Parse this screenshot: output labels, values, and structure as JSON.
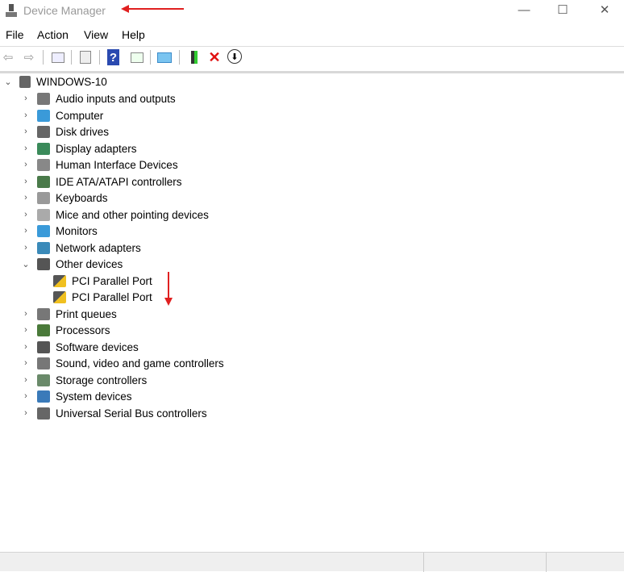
{
  "window": {
    "title": "Device Manager",
    "minimize": "—",
    "maximize": "☐",
    "close": "✕"
  },
  "menu": [
    "File",
    "Action",
    "View",
    "Help"
  ],
  "toolbar": {
    "back": "⇦",
    "forward": "⇨",
    "help": "?",
    "remove": "✕",
    "update": "⬇"
  },
  "tree": {
    "root": "WINDOWS-10",
    "items": [
      {
        "label": "Audio inputs and outputs",
        "color": "#777"
      },
      {
        "label": "Computer",
        "color": "#3a9ad9"
      },
      {
        "label": "Disk drives",
        "color": "#666"
      },
      {
        "label": "Display adapters",
        "color": "#3a8a5a"
      },
      {
        "label": "Human Interface Devices",
        "color": "#888"
      },
      {
        "label": "IDE ATA/ATAPI controllers",
        "color": "#4a7a4a"
      },
      {
        "label": "Keyboards",
        "color": "#999"
      },
      {
        "label": "Mice and other pointing devices",
        "color": "#aaa"
      },
      {
        "label": "Monitors",
        "color": "#3a9ad9"
      },
      {
        "label": "Network adapters",
        "color": "#3a8ab9"
      },
      {
        "label": "Other devices",
        "color": "#555",
        "expanded": true,
        "children": [
          "PCI Parallel Port",
          "PCI Parallel Port"
        ]
      },
      {
        "label": "Print queues",
        "color": "#777"
      },
      {
        "label": "Processors",
        "color": "#4a7a3a"
      },
      {
        "label": "Software devices",
        "color": "#555"
      },
      {
        "label": "Sound, video and game controllers",
        "color": "#777"
      },
      {
        "label": "Storage controllers",
        "color": "#6a8a6a"
      },
      {
        "label": "System devices",
        "color": "#3a7ab9"
      },
      {
        "label": "Universal Serial Bus controllers",
        "color": "#666"
      }
    ]
  }
}
